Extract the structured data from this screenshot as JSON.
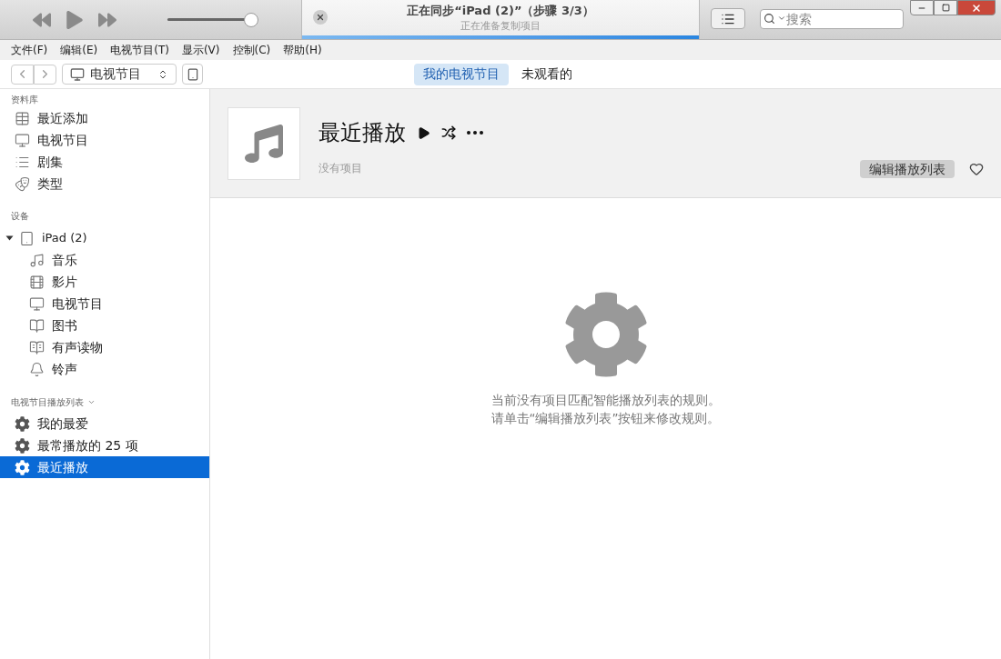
{
  "player": {
    "volume": {
      "level": 0.92
    }
  },
  "status": {
    "title": "正在同步“iPad (2)”（步骤 3/3）",
    "subtitle": "正在准备复制项目",
    "progress": {
      "level": 1
    }
  },
  "search": {
    "placeholder": "搜索"
  },
  "menu": [
    "文件(F)",
    "编辑(E)",
    "电视节目(T)",
    "显示(V)",
    "控制(C)",
    "帮助(H)"
  ],
  "media_picker": {
    "value": "电视节目"
  },
  "tabs": [
    {
      "label": "我的电视节目",
      "selected": true
    },
    {
      "label": "未观看的",
      "selected": false
    }
  ],
  "sidebar": {
    "library": {
      "heading": "资料库",
      "items": [
        {
          "kind": "grid",
          "label": "最近添加"
        },
        {
          "kind": "tv",
          "label": "电视节目"
        },
        {
          "kind": "list",
          "label": "剧集"
        },
        {
          "kind": "masks",
          "label": "类型"
        }
      ]
    },
    "devices": {
      "heading": "设备",
      "items": [
        {
          "label": "iPad (2)",
          "expanded": true,
          "children": [
            {
              "kind": "music",
              "label": "音乐"
            },
            {
              "kind": "film",
              "label": "影片"
            },
            {
              "kind": "tv",
              "label": "电视节目"
            },
            {
              "kind": "book",
              "label": "图书"
            },
            {
              "kind": "audiobook",
              "label": "有声读物"
            },
            {
              "kind": "bell",
              "label": "铃声"
            }
          ]
        }
      ]
    },
    "playlists": {
      "heading": "电视节目播放列表",
      "items": [
        {
          "label": "我的最爱",
          "selected": false
        },
        {
          "label": "最常播放的 25 项",
          "selected": false
        },
        {
          "label": "最近播放",
          "selected": true
        }
      ]
    }
  },
  "playlist": {
    "title": "最近播放",
    "subtitle": "没有项目",
    "edit_button": "编辑播放列表",
    "empty_message": [
      "当前没有项目匹配智能播放列表的规则。",
      "请单击“编辑播放列表”按钮来修改规则。"
    ]
  }
}
